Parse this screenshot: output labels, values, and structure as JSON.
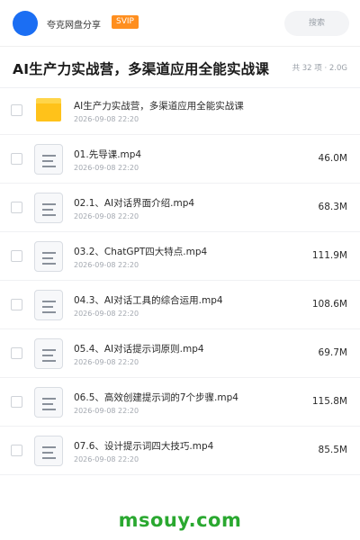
{
  "header": {
    "brand": "夸克网盘分享",
    "badge": "SVIP",
    "search_placeholder": "搜索"
  },
  "share": {
    "title": "AI生产力实战营，多渠道应用全能实战课",
    "meta": "共 32 项 · 2.0G"
  },
  "items": [
    {
      "type": "folder",
      "icon": "folder-icon",
      "name": "AI生产力实战营，多渠道应用全能实战课",
      "date": "2026-09-08 22:20",
      "size": ""
    },
    {
      "type": "file",
      "icon": "file-icon",
      "name": "01.先导课.mp4",
      "date": "2026-09-08 22:20",
      "size": "46.0M"
    },
    {
      "type": "file",
      "icon": "file-icon",
      "name": "02.1、AI对话界面介绍.mp4",
      "date": "2026-09-08 22:20",
      "size": "68.3M"
    },
    {
      "type": "file",
      "icon": "file-icon",
      "name": "03.2、ChatGPT四大特点.mp4",
      "date": "2026-09-08 22:20",
      "size": "111.9M"
    },
    {
      "type": "file",
      "icon": "file-icon",
      "name": "04.3、AI对话工具的综合运用.mp4",
      "date": "2026-09-08 22:20",
      "size": "108.6M"
    },
    {
      "type": "file",
      "icon": "file-icon",
      "name": "05.4、AI对话提示词原则.mp4",
      "date": "2026-09-08 22:20",
      "size": "69.7M"
    },
    {
      "type": "file",
      "icon": "file-icon",
      "name": "06.5、高效创建提示词的7个步骤.mp4",
      "date": "2026-09-08 22:20",
      "size": "115.8M"
    },
    {
      "type": "file",
      "icon": "file-icon",
      "name": "07.6、设计提示词四大技巧.mp4",
      "date": "2026-09-08 22:20",
      "size": "85.5M"
    }
  ],
  "watermark": "msouy.com",
  "colors": {
    "accent": "#1b6ef3",
    "svip": "#ff8f1f",
    "folder": "#ffc21a",
    "watermark": "#2aa830"
  }
}
